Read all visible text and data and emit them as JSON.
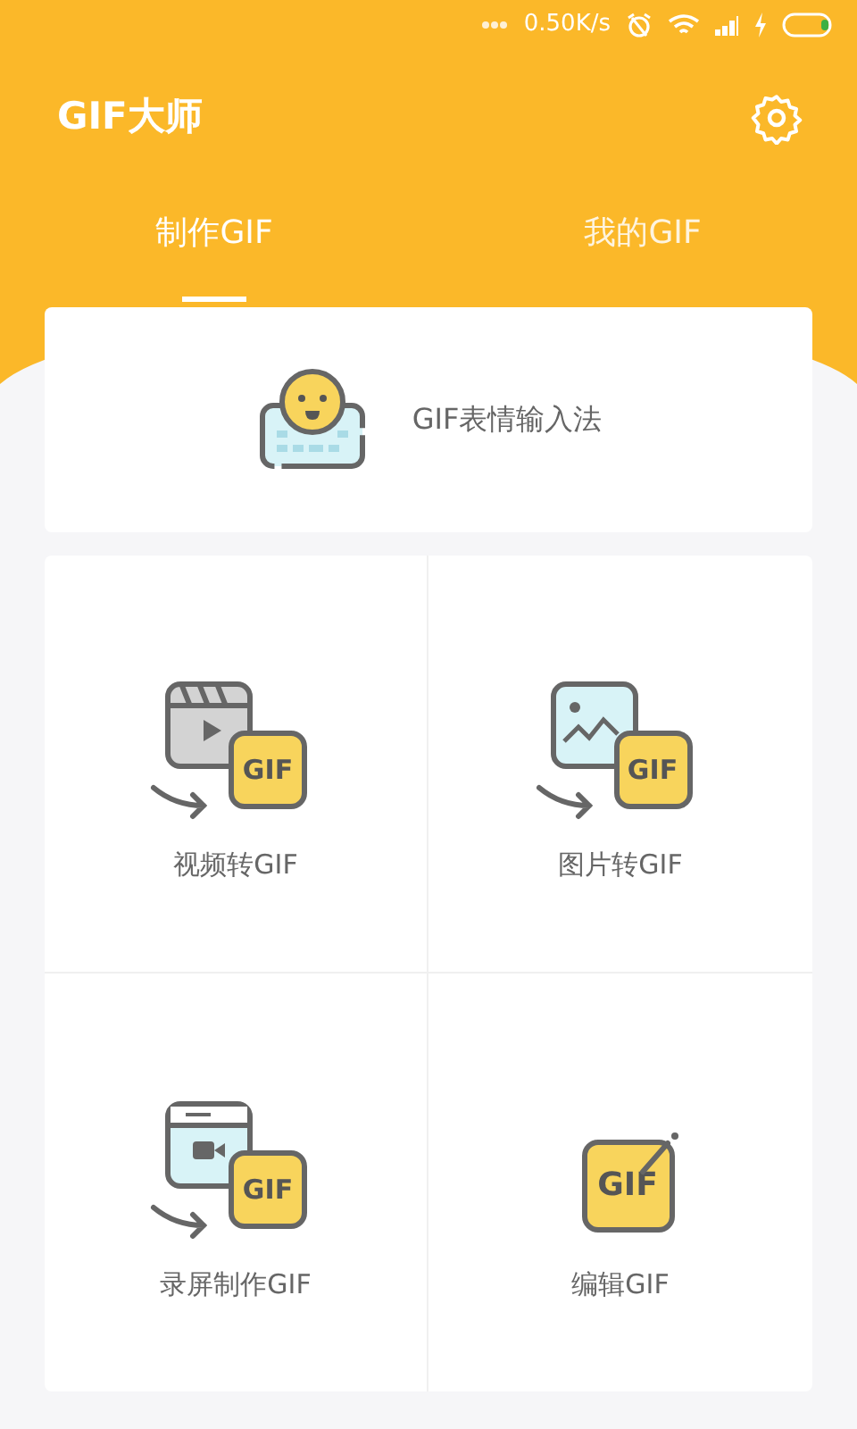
{
  "status_bar": {
    "speed": "0.50K/s"
  },
  "app_title": "GIF大师",
  "tabs": [
    {
      "label": "制作GIF",
      "selected": true
    },
    {
      "label": "我的GIF",
      "selected": false
    }
  ],
  "keyboard_card": {
    "label": "GIF表情输入法"
  },
  "tools": [
    {
      "kind": "video",
      "badge": "GIF",
      "label": "视频转GIF"
    },
    {
      "kind": "image",
      "badge": "GIF",
      "label": "图片转GIF"
    },
    {
      "kind": "screen",
      "badge": "GIF",
      "label": "录屏制作GIF"
    },
    {
      "kind": "edit",
      "badge": "GIF",
      "label": "编辑GIF"
    }
  ]
}
